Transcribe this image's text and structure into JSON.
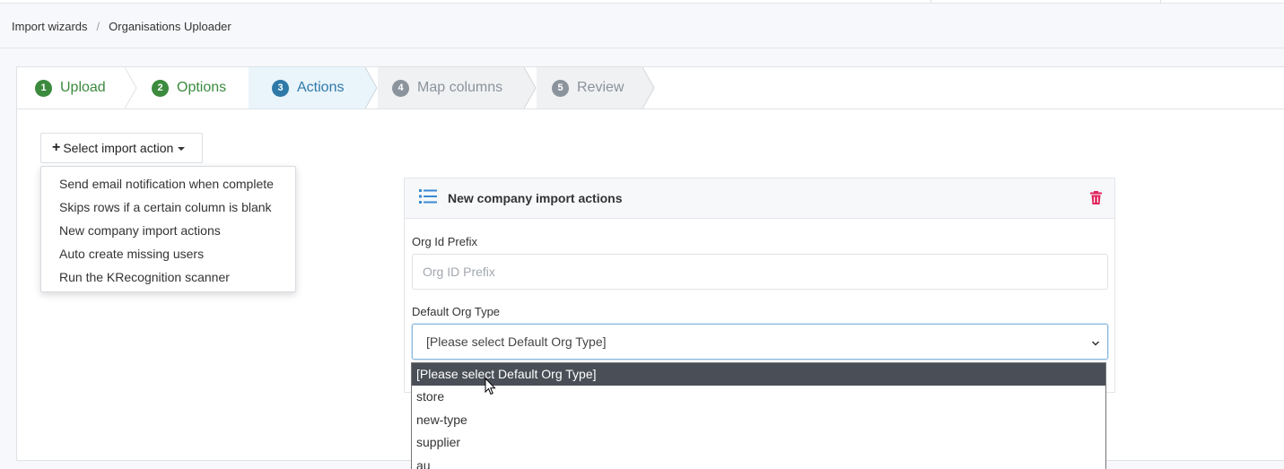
{
  "breadcrumb": {
    "items": [
      "Import wizards",
      "Organisations Uploader"
    ],
    "separator": "/"
  },
  "wizard": {
    "steps": [
      {
        "num": "1",
        "label": "Upload",
        "state": "done"
      },
      {
        "num": "2",
        "label": "Options",
        "state": "done"
      },
      {
        "num": "3",
        "label": "Actions",
        "state": "active"
      },
      {
        "num": "4",
        "label": "Map columns",
        "state": "todo"
      },
      {
        "num": "5",
        "label": "Review",
        "state": "todo"
      }
    ]
  },
  "action_button": {
    "label": "Select import action",
    "icon": "plus-icon"
  },
  "action_menu": {
    "items": [
      "Send email notification when complete",
      "Skips rows if a certain column is blank",
      "New company import actions",
      "Auto create missing users",
      "Run the KRecognition scanner"
    ]
  },
  "card": {
    "title": "New company import actions",
    "icon": "list-icon",
    "delete_icon": "trash-icon",
    "org_id_prefix": {
      "label": "Org Id Prefix",
      "placeholder": "Org ID Prefix",
      "value": ""
    },
    "default_org_type": {
      "label": "Default Org Type",
      "selected": "[Please select Default Org Type]"
    }
  },
  "org_type_options": [
    "[Please select Default Org Type]",
    "store",
    "new-type",
    "supplier",
    "au"
  ],
  "colors": {
    "done": "#3b8a3e",
    "active": "#2e79a8",
    "todo": "#8b939c",
    "accent_blue": "#3a8ad0",
    "danger": "#e0245e"
  }
}
